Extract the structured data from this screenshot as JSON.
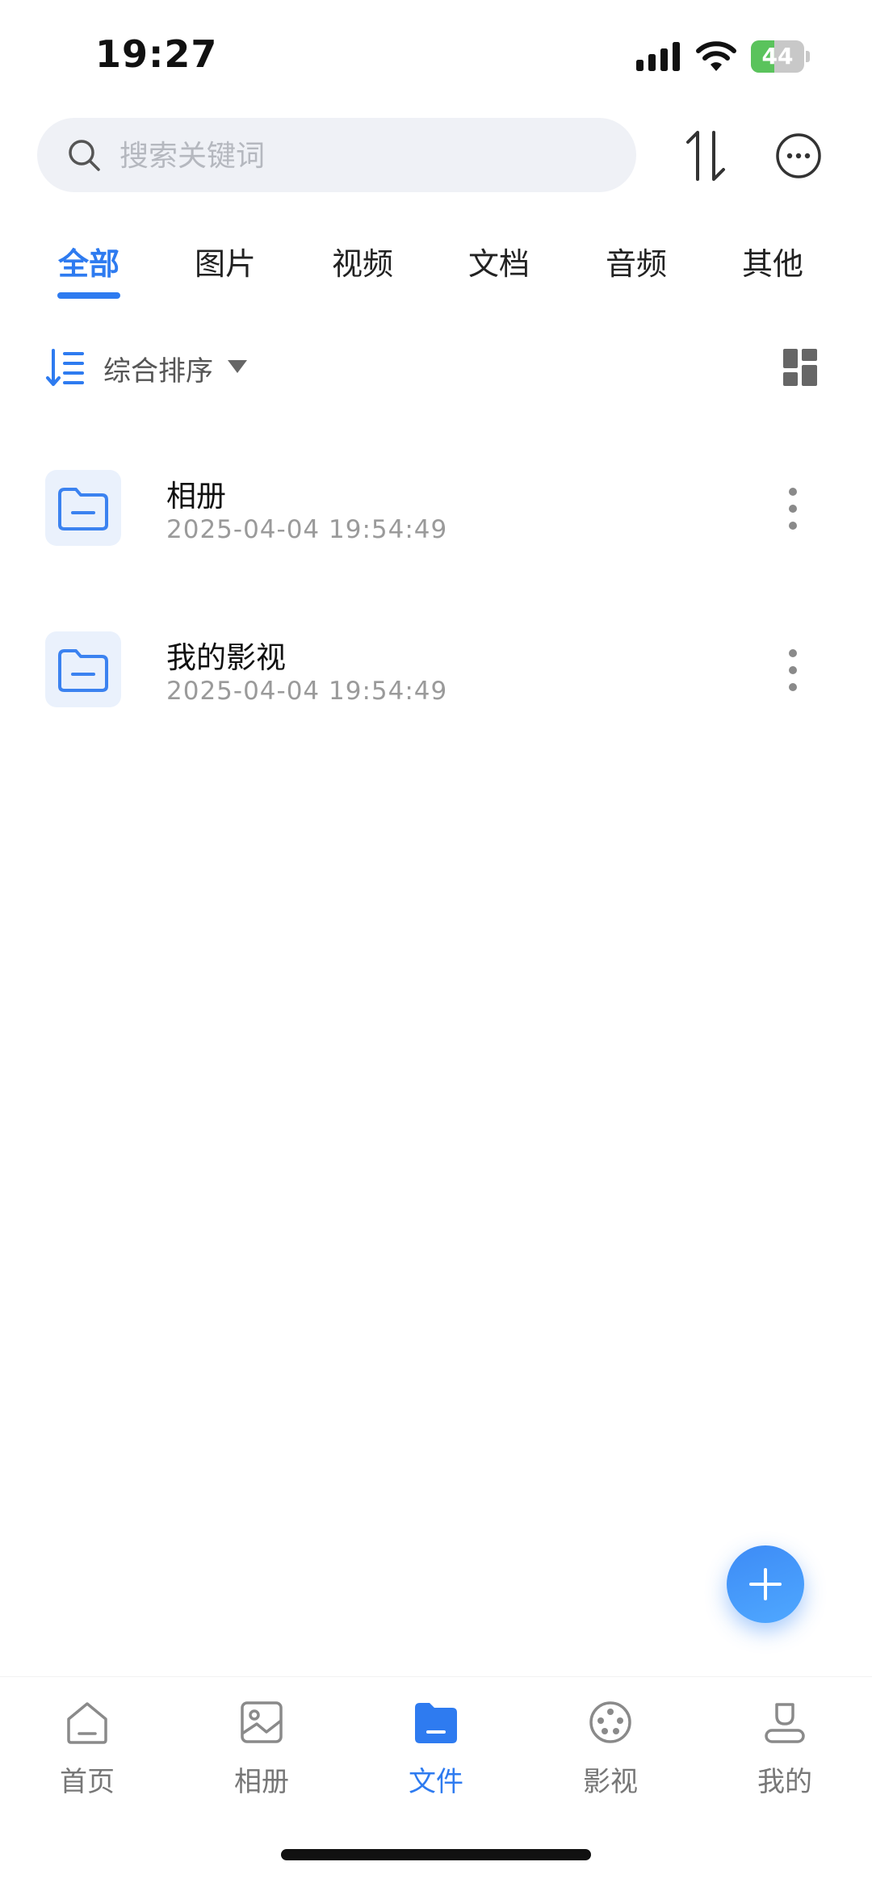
{
  "status": {
    "time": "19:27",
    "battery": "44",
    "battery_level": 0.44
  },
  "search": {
    "placeholder": "搜索关键词"
  },
  "tabs": [
    {
      "label": "全部",
      "active": true
    },
    {
      "label": "图片",
      "active": false
    },
    {
      "label": "视频",
      "active": false
    },
    {
      "label": "文档",
      "active": false
    },
    {
      "label": "音频",
      "active": false
    },
    {
      "label": "其他",
      "active": false
    }
  ],
  "sort": {
    "label": "综合排序"
  },
  "files": [
    {
      "name": "相册",
      "date": "2025-04-04 19:54:49"
    },
    {
      "name": "我的影视",
      "date": "2025-04-04 19:54:49"
    }
  ],
  "nav": [
    {
      "label": "首页",
      "icon": "home-icon",
      "active": false
    },
    {
      "label": "相册",
      "icon": "album-icon",
      "active": false
    },
    {
      "label": "文件",
      "icon": "folder-icon",
      "active": true
    },
    {
      "label": "影视",
      "icon": "film-reel-icon",
      "active": false
    },
    {
      "label": "我的",
      "icon": "profile-icon",
      "active": false
    }
  ],
  "colors": {
    "accent": "#2e7bf0",
    "battery": "#5ac35c",
    "folder_tile": "#eaf1fc"
  }
}
